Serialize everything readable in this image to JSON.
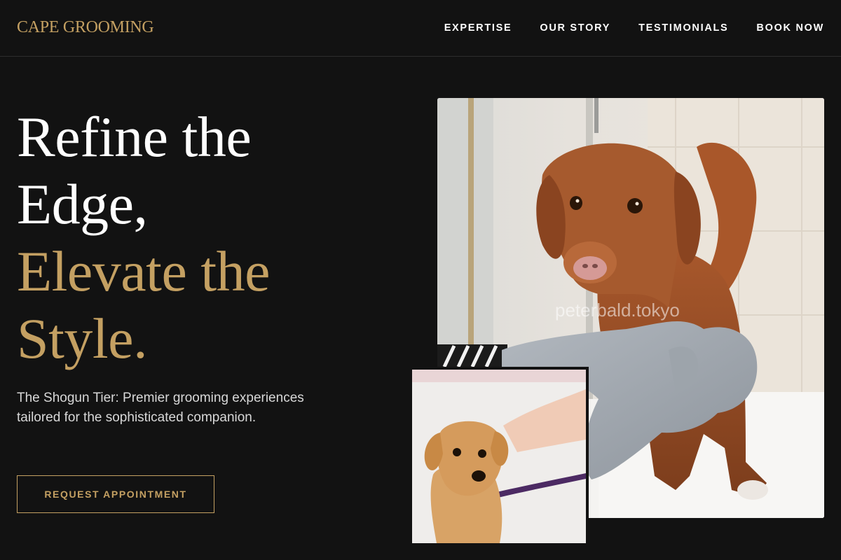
{
  "header": {
    "logo": "CAPE GROOMING",
    "nav": [
      {
        "label": "EXPERTISE"
      },
      {
        "label": "OUR STORY"
      },
      {
        "label": "TESTIMONIALS"
      },
      {
        "label": "BOOK NOW"
      }
    ]
  },
  "hero": {
    "title_line1": "Refine the",
    "title_line2": "Edge,",
    "title_line3": "Elevate the",
    "title_line4": "Style.",
    "subtitle": "The Shogun Tier: Premier grooming experiences tailored for the sophisticated companion.",
    "cta_label": "REQUEST APPOINTMENT"
  },
  "images": {
    "main_watermark": "peterbald.tokyo",
    "main_icon": "wet-dog-photo",
    "inset_icon": "small-dog-photo"
  },
  "colors": {
    "background": "#121212",
    "accent_gold": "#c4a062",
    "text_light": "#ffffff"
  }
}
